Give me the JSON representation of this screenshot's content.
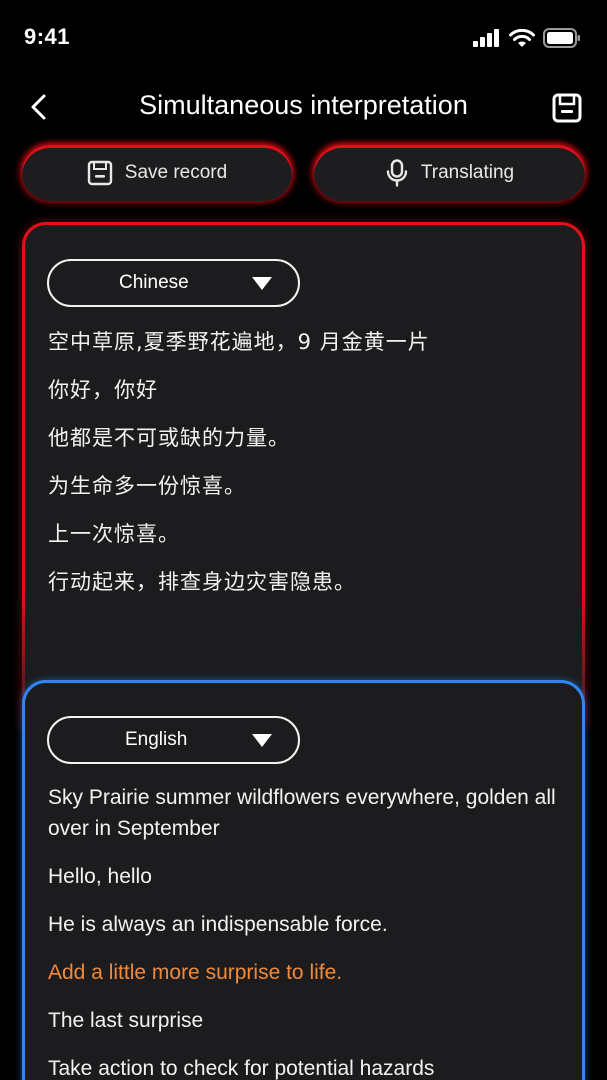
{
  "status": {
    "time": "9:41"
  },
  "nav": {
    "title": "Simultaneous interpretation"
  },
  "actions": {
    "save_label": "Save record",
    "translate_label": "Translating"
  },
  "source": {
    "language": "Chinese",
    "lines": [
      "空中草原,夏季野花遍地，9 月金黄一片",
      "你好，你好",
      "他都是不可或缺的力量。",
      "为生命多一份惊喜。",
      "上一次惊喜。",
      "行动起来，排查身边灾害隐患。"
    ]
  },
  "target": {
    "language": "English",
    "lines": [
      "Sky Prairie summer wildflowers everywhere, golden all over in September",
      "Hello, hello",
      "He is always an indispensable force.",
      "Add a little more surprise to life.",
      "The last surprise",
      "Take action to check for potential hazards"
    ],
    "highlight_index": 3
  },
  "colors": {
    "accent_red": "#e3101a",
    "accent_blue": "#2f86f0",
    "highlight": "#f08a3a",
    "card_bg": "#1c1c1e"
  },
  "icons": [
    "back-icon",
    "save-icon",
    "floppy-icon",
    "microphone-icon",
    "signal-icon",
    "wifi-icon",
    "battery-icon",
    "caret-down-icon"
  ]
}
